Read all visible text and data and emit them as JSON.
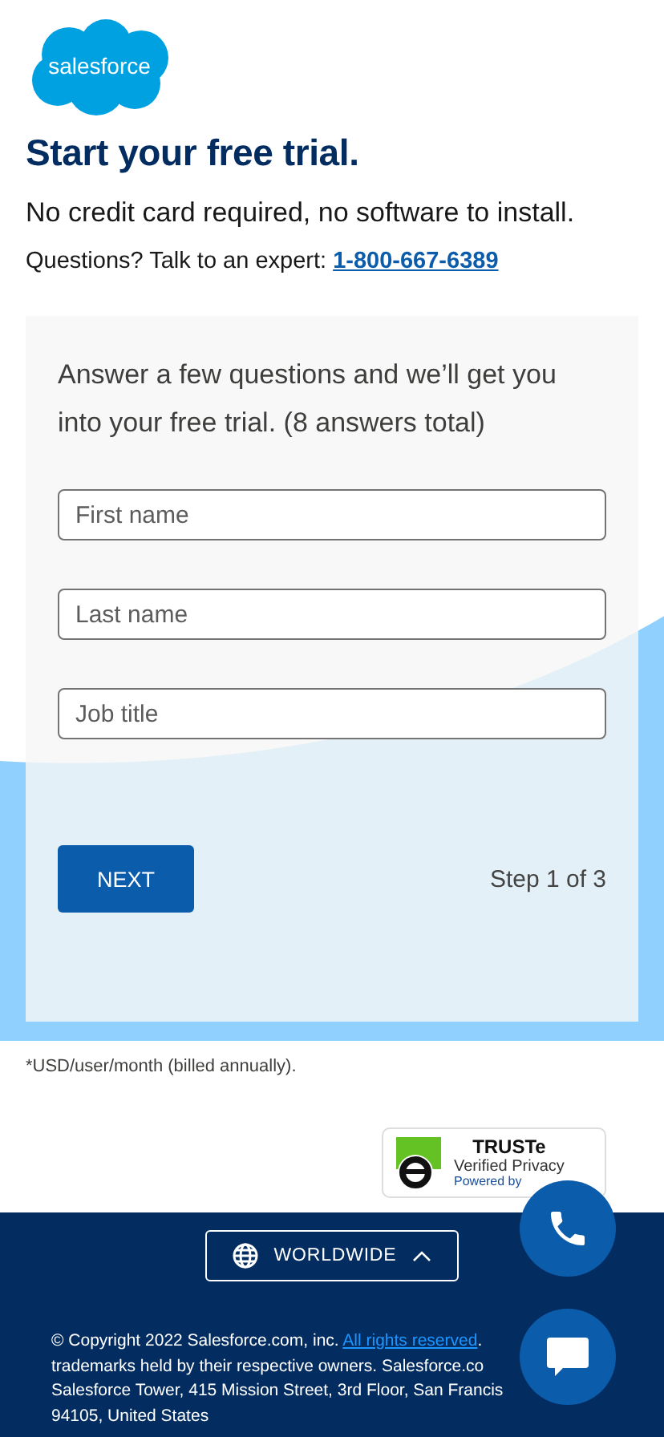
{
  "logo": {
    "text": "salesforce"
  },
  "heading": "Start your free trial.",
  "subtitle": "No credit card required, no software to install.",
  "questions": {
    "text": "Questions? Talk to an expert:",
    "phone": "1-800-667-6389"
  },
  "form": {
    "intro": "Answer a few questions and we’ll get you into your free trial. (8 answers total)",
    "fields": [
      {
        "placeholder": "First name"
      },
      {
        "placeholder": "Last name"
      },
      {
        "placeholder": "Job title"
      }
    ],
    "button": "NEXT",
    "step": "Step 1 of 3"
  },
  "footnote": "*USD/user/month (billed annually).",
  "badge": {
    "title": "TRUSTe",
    "subtitle": "Verified Privacy",
    "powered": "Powered by"
  },
  "footer": {
    "region_button": "WORLDWIDE",
    "copyright": {
      "text": "© Copyright 2022 Salesforce.com, inc. ",
      "link": "All rights reserved",
      "after": "."
    },
    "lines": [
      "trademarks held by their respective owners. Salesforce.co",
      "Salesforce Tower, 415 Mission Street, 3rd Floor, San Francis",
      "94105, United States"
    ]
  }
}
